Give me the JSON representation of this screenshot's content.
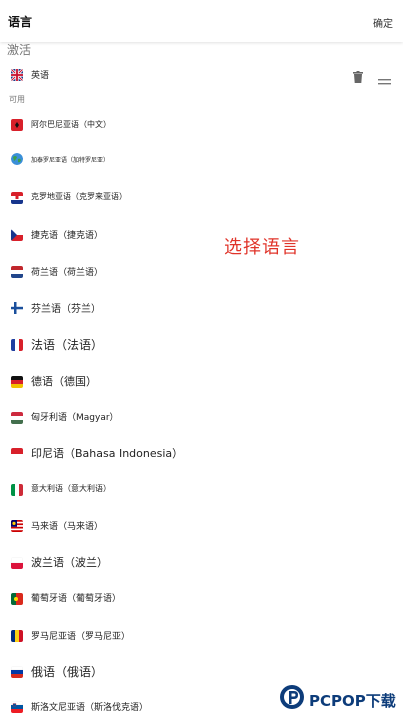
{
  "header": {
    "title": "语言",
    "confirm_label": "确定"
  },
  "sections": {
    "active_label": "激活",
    "available_label": "可用"
  },
  "active_language": {
    "label": "英语",
    "flag": "uk-flag-icon"
  },
  "languages": [
    {
      "label": "阿尔巴尼亚语（中文）",
      "flag": "albania-flag-icon"
    },
    {
      "label": "加泰罗尼亚语（加特罗尼亚）",
      "flag": "globe-icon"
    },
    {
      "label": "克罗地亚语（克罗来亚语）",
      "flag": "croatia-flag-icon"
    },
    {
      "label": "捷克语（捷克语）",
      "flag": "czech-flag-icon"
    },
    {
      "label": "荷兰语（荷兰语）",
      "flag": "netherlands-flag-icon"
    },
    {
      "label": "芬兰语（芬兰）",
      "flag": "finland-flag-icon"
    },
    {
      "label": "法语（法语）",
      "flag": "france-flag-icon"
    },
    {
      "label": "德语（德国）",
      "flag": "germany-flag-icon"
    },
    {
      "label": "匈牙利语（Magyar）",
      "flag": "hungary-flag-icon"
    },
    {
      "label": "印尼语（Bahasa Indonesia）",
      "flag": "indonesia-flag-icon"
    },
    {
      "label": "意大利语（意大利语）",
      "flag": "italy-flag-icon"
    },
    {
      "label": "马来语（马来语）",
      "flag": "malaysia-flag-icon"
    },
    {
      "label": "波兰语（波兰）",
      "flag": "poland-flag-icon"
    },
    {
      "label": "葡萄牙语（葡萄牙语）",
      "flag": "portugal-flag-icon"
    },
    {
      "label": "罗马尼亚语（罗马尼亚）",
      "flag": "romania-flag-icon"
    },
    {
      "label": "俄语（俄语）",
      "flag": "russia-flag-icon"
    },
    {
      "label": "斯洛文尼亚语（斯洛伐克语）",
      "flag": "slovenia-flag-icon"
    }
  ],
  "overlay": {
    "caption": "选择语言"
  },
  "watermark": {
    "text": "PCPOP下载"
  },
  "colors": {
    "caption_red": "#e0342a",
    "watermark_blue": "#0d3c7a"
  }
}
